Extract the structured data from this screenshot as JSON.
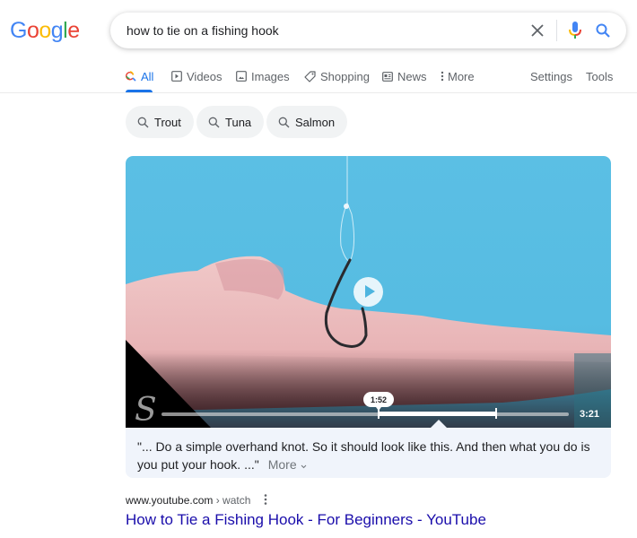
{
  "logo": {
    "letters": [
      "G",
      "o",
      "o",
      "g",
      "l",
      "e"
    ],
    "colors": [
      "#4285f4",
      "#ea4335",
      "#fbbc05",
      "#4285f4",
      "#34a853",
      "#ea4335"
    ]
  },
  "search": {
    "query": "how to tie on a fishing hook",
    "icons": [
      "clear-icon",
      "mic-icon",
      "search-icon"
    ]
  },
  "tabs": [
    {
      "label": "All",
      "icon": "search-icon",
      "active": true
    },
    {
      "label": "Videos",
      "icon": "video-icon",
      "active": false
    },
    {
      "label": "Images",
      "icon": "image-icon",
      "active": false
    },
    {
      "label": "Shopping",
      "icon": "tag-icon",
      "active": false
    },
    {
      "label": "News",
      "icon": "news-icon",
      "active": false
    },
    {
      "label": "More",
      "icon": "more-vert-icon",
      "active": false
    }
  ],
  "tools": {
    "settings_label": "Settings",
    "tools_label": "Tools"
  },
  "chips": [
    {
      "label": "Trout"
    },
    {
      "label": "Tuna"
    },
    {
      "label": "Salmon"
    }
  ],
  "video": {
    "current_time": "1:52",
    "duration": "3:21",
    "highlight_start_fraction": 0.557,
    "highlight_end_fraction": 0.846,
    "transcript": "\"... Do a simple overhand knot. So it should look like this. And then what you do is you put your hook. ...\"",
    "more_label": "More"
  },
  "result": {
    "domain": "www.youtube.com",
    "path": " › watch",
    "title": "How to Tie a Fishing Hook - For Beginners - YouTube"
  },
  "colors": {
    "accent": "#1a73e8",
    "link": "#1a0dab",
    "chip_bg": "#f1f3f4",
    "card_bg": "#f0f4fb"
  }
}
